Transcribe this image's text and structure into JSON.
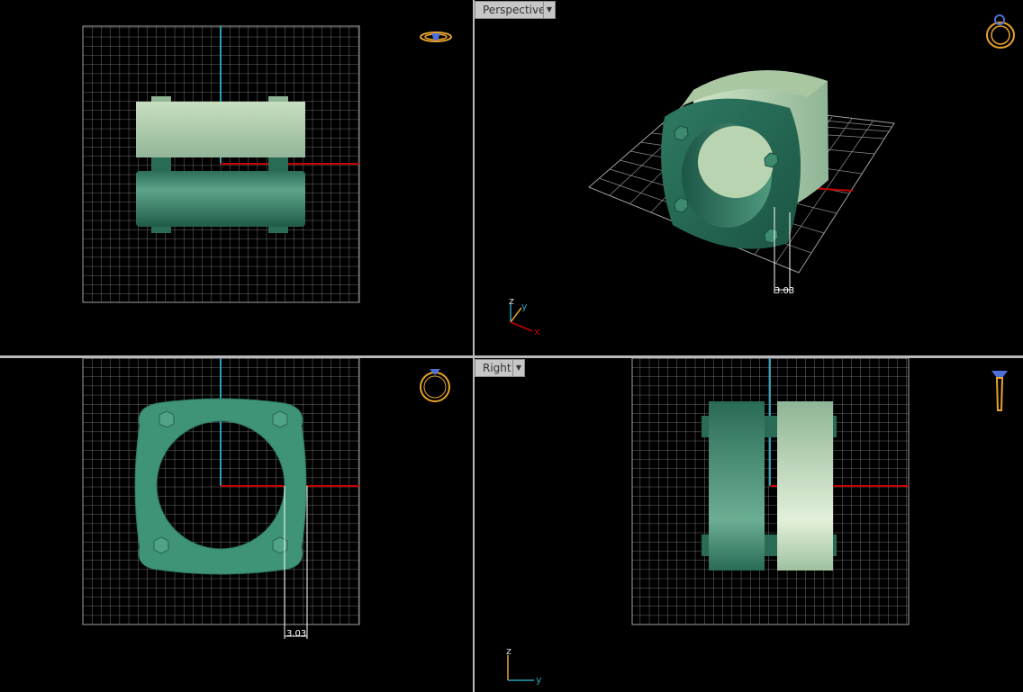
{
  "viewports": {
    "top": {
      "label": ""
    },
    "perspective": {
      "label": "Perspective",
      "menu_icon": "triangle-down-icon"
    },
    "front": {
      "label": ""
    },
    "right": {
      "label": "Right",
      "menu_icon": "triangle-down-icon"
    }
  },
  "dimensions": {
    "front_width": "3.03",
    "perspective_width": "3.03"
  },
  "axes": {
    "perspective": {
      "z": "z",
      "y": "y",
      "x": "x"
    },
    "right": {
      "z": "z",
      "y": "y"
    }
  },
  "icons": {
    "top": "ring-top-view-icon",
    "perspective": "ring-perspective-icon",
    "front": "ring-front-view-icon",
    "right": "ring-side-view-icon"
  },
  "colors": {
    "grid": "#9a9a9a",
    "axis_x": "#c40000",
    "axis_y": "#2aa0b8",
    "ring_dark": "#2f7a62",
    "ring_light": "#b6d2ae",
    "icon_gold": "#e8a22a",
    "icon_blue": "#4f6fd8"
  }
}
